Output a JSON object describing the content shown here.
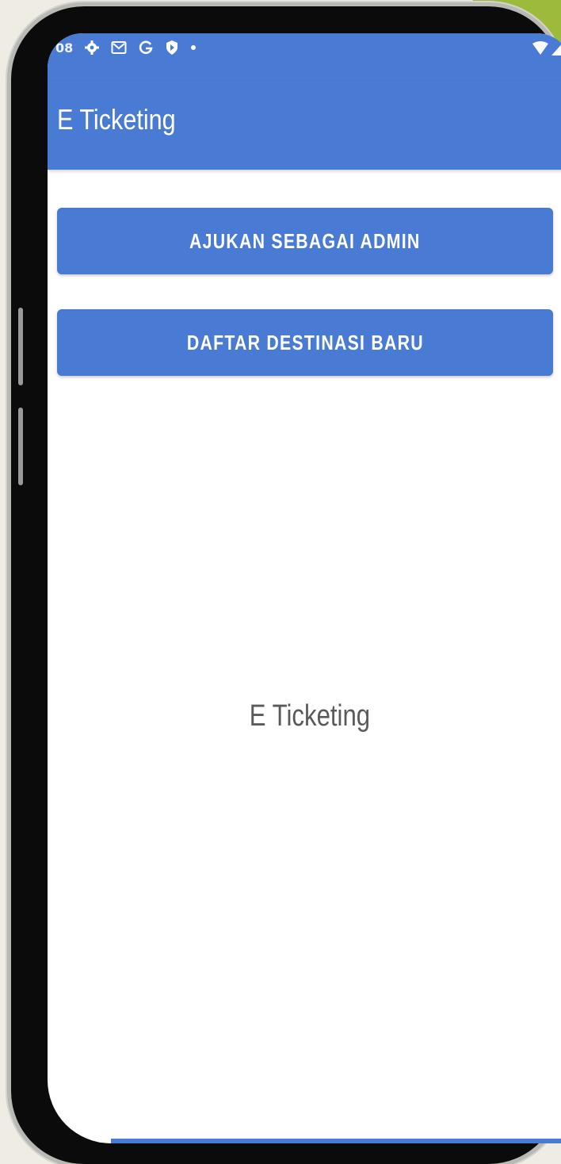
{
  "status_bar": {
    "time_fragment": "08",
    "left_icons": [
      "settings-icon",
      "gmail-icon",
      "google-icon",
      "shield-icon",
      "dot-icon"
    ],
    "right_icons": [
      "wifi-icon",
      "signal-icon"
    ]
  },
  "app_bar": {
    "title": "E Ticketing"
  },
  "buttons": {
    "apply_admin": "AJUKAN SEBAGAI ADMIN",
    "new_destination": "DAFTAR DESTINASI BARU"
  },
  "content": {
    "center_label": "E Ticketing"
  },
  "colors": {
    "primary": "#4a7bd4",
    "text_gray": "#5a5a5a",
    "background": "#ffffff"
  }
}
